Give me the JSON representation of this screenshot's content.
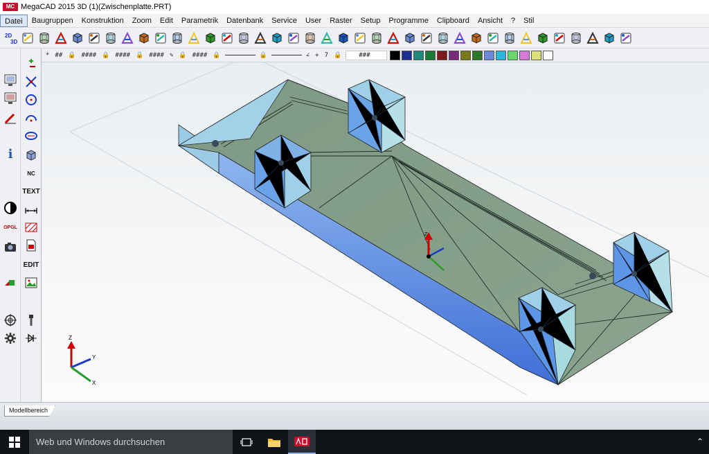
{
  "window": {
    "title": "MegaCAD 2015 3D (1)(Zwischenplatte.PRT)",
    "logo": "MC"
  },
  "menu": [
    {
      "label": "Datei",
      "active": true
    },
    {
      "label": "Baugruppen"
    },
    {
      "label": "Konstruktion"
    },
    {
      "label": "Zoom"
    },
    {
      "label": "Edit"
    },
    {
      "label": "Parametrik"
    },
    {
      "label": "Datenbank"
    },
    {
      "label": "Service"
    },
    {
      "label": "User"
    },
    {
      "label": "Raster"
    },
    {
      "label": "Setup"
    },
    {
      "label": "Programme"
    },
    {
      "label": "Clipboard"
    },
    {
      "label": "Ansicht"
    },
    {
      "label": "?"
    },
    {
      "label": "Stil"
    }
  ],
  "toolbar": {
    "icons": [
      "2d-3d-switch-icon",
      "new-file-icon",
      "open-folder-icon",
      "save-mf-icon",
      "save-2d-icon",
      "print-icon",
      "save-dxf-icon",
      "layers-icon",
      "redraw-icon",
      "measure-icon",
      "delete-icon",
      "undo-icon",
      "redo-icon",
      "axis-icon",
      "add-3d-icon",
      "move-icon",
      "intersect-icon",
      "transform-icon",
      "rotate-icon",
      "mirror-icon",
      "reference-icon",
      "layout-icon",
      "box-view-icon",
      "box-front-icon",
      "box-side-icon",
      "box-top-icon",
      "box-iso-icon",
      "render-icon",
      "shade-icon",
      "cylinder-1-icon",
      "cylinder-2-icon",
      "cylinder-3-icon",
      "cylinder-4-icon",
      "opengl-icon",
      "layer-manager-icon",
      "explorer-icon",
      "settings-check-icon",
      "network-icon"
    ]
  },
  "toolbar2": {
    "labels": [
      "*",
      "##",
      "####",
      "####",
      "####",
      "####",
      "###"
    ],
    "colors": [
      "#000000",
      "#1e2e8f",
      "#1f8a7a",
      "#1a7a36",
      "#7a1a1a",
      "#7a2a7a",
      "#7a7a1a",
      "#2a7a2a",
      "#6a8ad8",
      "#2ab8d8",
      "#6ad86a",
      "#d87ad8",
      "#e0e07a",
      "#ffffff"
    ]
  },
  "left1": {
    "text_labels": {
      "info": "i"
    }
  },
  "left2": {
    "text_labels": {
      "text": "TEXT",
      "edit": "EDIT",
      "opgl": "OPGL",
      "nc": "NC"
    }
  },
  "viewport": {
    "axis_labels": {
      "x": "X",
      "y": "Y",
      "z": "Z"
    }
  },
  "tabs": {
    "model": "Modellbereich"
  },
  "taskbar": {
    "search_placeholder": "Web und Windows durchsuchen"
  }
}
